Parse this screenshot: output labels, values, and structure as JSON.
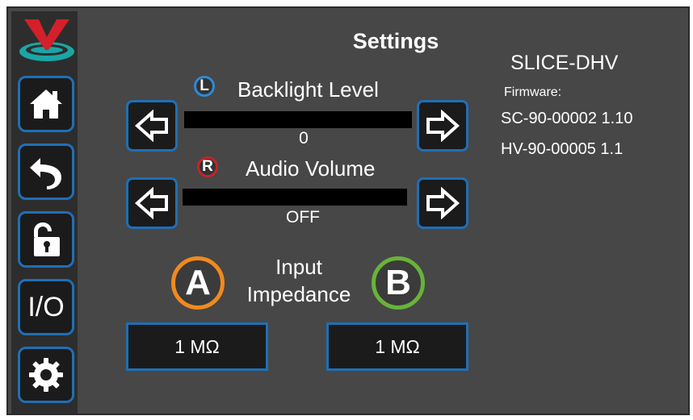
{
  "header": {
    "title": "Settings"
  },
  "device": {
    "name": "SLICE-DHV",
    "firmware_label": "Firmware:",
    "firmware_lines": [
      "SC-90-00002 1.10",
      "HV-90-00005 1.1"
    ]
  },
  "backlight": {
    "badge": "L",
    "label": "Backlight Level",
    "value": "0",
    "badge_color": "#2e8ad6"
  },
  "audio": {
    "badge": "R",
    "label": "Audio Volume",
    "value": "OFF",
    "badge_color": "#c0252b"
  },
  "impedance": {
    "label_line1": "Input",
    "label_line2": "Impedance",
    "a": {
      "badge": "A",
      "value": "1 MΩ",
      "color": "#f08a1e"
    },
    "b": {
      "badge": "B",
      "value": "1 MΩ",
      "color": "#68b33a"
    }
  },
  "sidebar": {
    "items": [
      {
        "icon": "logo-icon"
      },
      {
        "icon": "home-icon"
      },
      {
        "icon": "back-icon"
      },
      {
        "icon": "unlock-icon"
      },
      {
        "icon": "io-icon",
        "label": "I/O"
      },
      {
        "icon": "gear-icon"
      }
    ]
  },
  "colors": {
    "accent": "#1f6fb6",
    "panel": "#474747",
    "sidebar": "#2d2d2d"
  }
}
